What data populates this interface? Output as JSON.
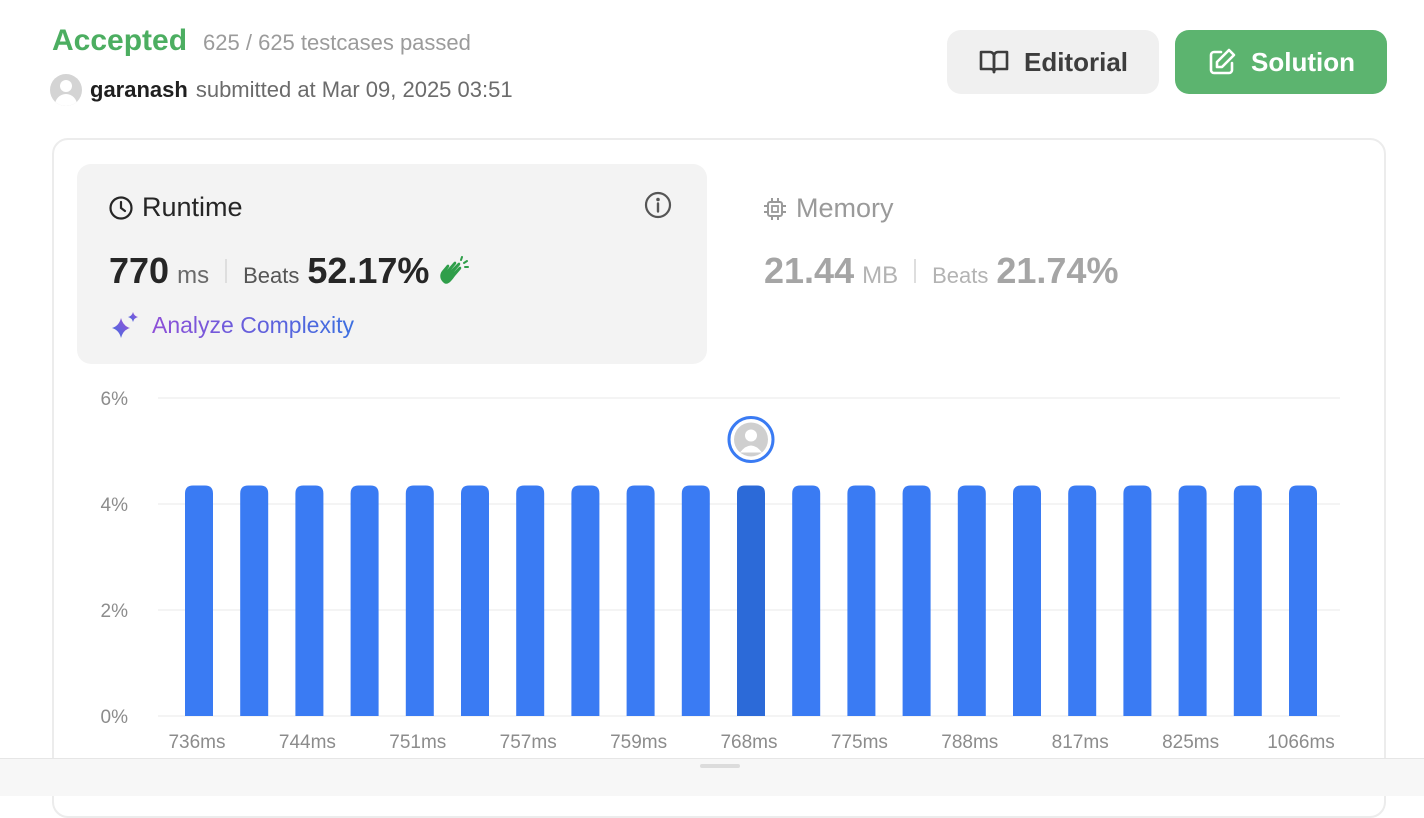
{
  "header": {
    "status": "Accepted",
    "testcases": "625 / 625 testcases passed",
    "username": "garanash",
    "submitted": "submitted at Mar 09, 2025 03:51"
  },
  "buttons": {
    "editorial": "Editorial",
    "solution": "Solution"
  },
  "runtime": {
    "title": "Runtime",
    "value": "770",
    "unit": "ms",
    "beats_label": "Beats",
    "beats_value": "52.17%",
    "analyze_label": "Analyze Complexity"
  },
  "memory": {
    "title": "Memory",
    "value": "21.44",
    "unit": "MB",
    "beats_label": "Beats",
    "beats_value": "21.74%"
  },
  "colors": {
    "accent_green": "#4cae61",
    "bar": "#3a7bf3",
    "bar_highlight": "#2c6ad8"
  },
  "chart_data": {
    "type": "bar",
    "ylim": [
      0,
      6
    ],
    "y_ticks": [
      "0%",
      "2%",
      "4%",
      "6%"
    ],
    "x_tick_labels": [
      "736ms",
      "744ms",
      "751ms",
      "757ms",
      "759ms",
      "768ms",
      "775ms",
      "788ms",
      "817ms",
      "825ms",
      "1066ms"
    ],
    "values": [
      4.35,
      4.35,
      4.35,
      4.35,
      4.35,
      4.35,
      4.35,
      4.35,
      4.35,
      4.35,
      4.35,
      4.35,
      4.35,
      4.35,
      4.35,
      4.35,
      4.35,
      4.35,
      4.35,
      4.35,
      4.35
    ],
    "highlight_index": 10,
    "grid": true
  }
}
